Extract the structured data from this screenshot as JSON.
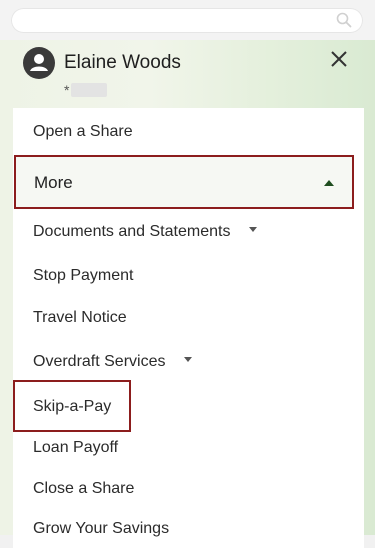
{
  "search": {
    "placeholder": ""
  },
  "user": {
    "name": "Elaine Woods",
    "account_prefix": "*"
  },
  "menu": {
    "items": [
      {
        "label": "Open a Share"
      },
      {
        "label": "More"
      },
      {
        "label": "Documents and Statements"
      },
      {
        "label": "Stop Payment"
      },
      {
        "label": "Travel Notice"
      },
      {
        "label": "Overdraft Services"
      },
      {
        "label": "Skip-a-Pay"
      },
      {
        "label": "Loan Payoff"
      },
      {
        "label": "Close a Share"
      },
      {
        "label": "Grow Your Savings"
      }
    ]
  },
  "colors": {
    "highlight_border": "#8c1d1d",
    "caret_active": "#1e4d1e"
  }
}
